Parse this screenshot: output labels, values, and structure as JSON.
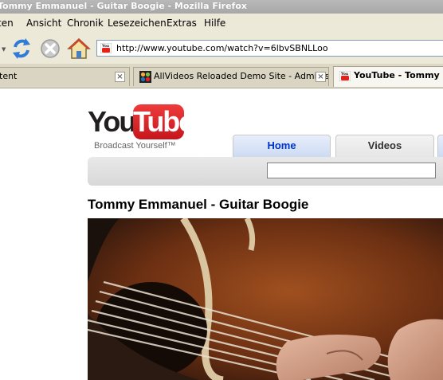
{
  "window": {
    "title": "Tommy Emmanuel - Guitar Boogie - Mozilla Firefox"
  },
  "menu": {
    "items": [
      {
        "label": "ten"
      },
      {
        "label": "Ansicht"
      },
      {
        "label": "Chronik"
      },
      {
        "label": "Lesezeichen"
      },
      {
        "label": "Extras"
      },
      {
        "label": "Hilfe"
      }
    ]
  },
  "navbar": {
    "url": "http://www.youtube.com/watch?v=6lbvSBNLLoo"
  },
  "tabs": [
    {
      "label": "tent",
      "active": false
    },
    {
      "label": "AllVideos Reloaded Demo Site - Adminis...",
      "active": false
    },
    {
      "label": "YouTube - Tommy E",
      "active": true
    }
  ],
  "youtube": {
    "logo_you": "You",
    "logo_tube": "Tube",
    "slogan": "Broadcast Yourself™",
    "tabs": {
      "home": "Home",
      "videos": "Videos"
    },
    "search": {
      "value": ""
    },
    "video_title": "Tommy Emmanuel - Guitar Boogie"
  },
  "colors": {
    "youtube_red": "#e62117",
    "link_blue": "#0033cc",
    "chrome_beige": "#ece9d8"
  },
  "icons": [
    "reload-icon",
    "stop-icon",
    "home-icon",
    "youtube-favicon",
    "close-tab-icon",
    "joomla-favicon"
  ]
}
